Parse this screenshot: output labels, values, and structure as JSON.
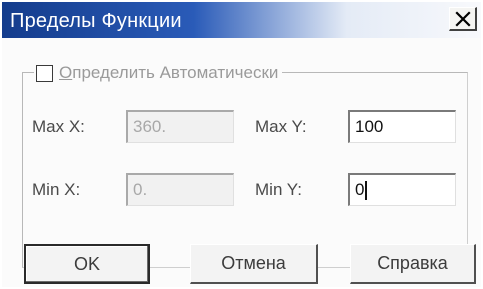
{
  "window": {
    "title": "Пределы Функции",
    "close_symbol": "X"
  },
  "auto_define": {
    "label_underlined": "О",
    "label_rest": "пределить Автоматически",
    "checked": false
  },
  "fields": {
    "max_x": {
      "label": "Max X:",
      "value": "360.",
      "enabled": false
    },
    "min_x": {
      "label": "Min X:",
      "value": "0.",
      "enabled": false
    },
    "max_y": {
      "label": "Max Y:",
      "value": "100",
      "enabled": true
    },
    "min_y": {
      "label": "Min Y:",
      "value": "0",
      "enabled": true
    }
  },
  "buttons": {
    "ok": "OK",
    "cancel": "Отмена",
    "help": "Справка"
  }
}
